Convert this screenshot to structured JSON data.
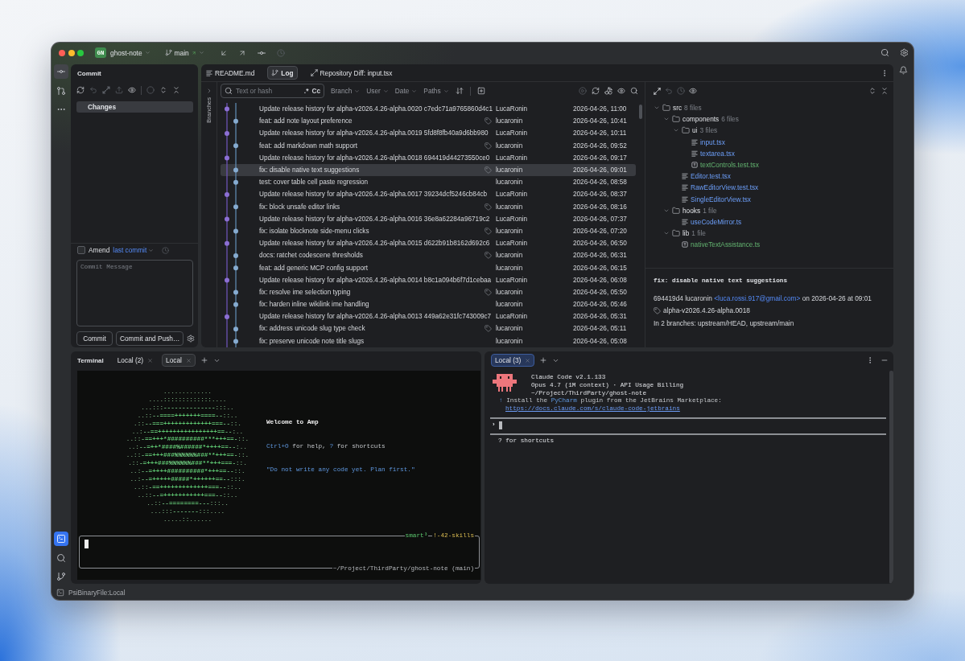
{
  "window": {
    "project_badge": "GN",
    "project": "ghost-note",
    "branch": "main"
  },
  "tool_strip": {
    "top": [
      {
        "selected": true
      },
      {
        "selected": false
      },
      {
        "selected": false
      }
    ],
    "bottom": [
      {
        "selected": true
      },
      {
        "selected": false
      },
      {
        "selected": false
      }
    ]
  },
  "commit_panel": {
    "title": "Commit",
    "changes": {
      "label": "Changes",
      "selected": true
    },
    "amend": {
      "checked": false,
      "label": "Amend",
      "link": "last commit"
    },
    "message": {
      "placeholder": "Commit Message"
    },
    "buttons": [
      "Commit",
      "Commit and Push…"
    ]
  },
  "editor_tabs": [
    {
      "label": "README.md",
      "selected": false
    },
    {
      "label": "Log",
      "selected": true
    },
    {
      "label": "Repository Diff: input.tsx",
      "selected": false
    }
  ],
  "log": {
    "branches_label": "Branches",
    "search": {
      "placeholder": "Text or hash",
      "regex": ".*",
      "match_case": "Cc"
    },
    "filters": [
      "Branch",
      "User",
      "Date",
      "Paths"
    ],
    "rows": [
      {
        "kind": "left",
        "message": "Update release history for alpha-v2026.4.26-alpha.0020 c7edc71a9765860d4c1",
        "tagged": false,
        "author": "LucaRonin",
        "date": "2026-04-26, 11:00",
        "selected": false
      },
      {
        "kind": "right",
        "message": "feat: add note layout preference",
        "tagged": true,
        "author": "lucaronin",
        "date": "2026-04-26, 10:41",
        "selected": false
      },
      {
        "kind": "left",
        "message": "Update release history for alpha-v2026.4.26-alpha.0019 5fd8f8fb40a9d6bb980",
        "tagged": false,
        "author": "LucaRonin",
        "date": "2026-04-26, 10:11",
        "selected": false
      },
      {
        "kind": "right",
        "message": "feat: add markdown math support",
        "tagged": true,
        "author": "lucaronin",
        "date": "2026-04-26, 09:52",
        "selected": false
      },
      {
        "kind": "left",
        "message": "Update release history for alpha-v2026.4.26-alpha.0018 694419d44273550ce0",
        "tagged": false,
        "author": "LucaRonin",
        "date": "2026-04-26, 09:17",
        "selected": false
      },
      {
        "kind": "right",
        "message": "fix: disable native text suggestions",
        "tagged": true,
        "author": "lucaronin",
        "date": "2026-04-26, 09:01",
        "selected": true
      },
      {
        "kind": "right",
        "message": "test: cover table cell paste regression",
        "tagged": false,
        "author": "lucaronin",
        "date": "2026-04-26, 08:58",
        "selected": false
      },
      {
        "kind": "left",
        "message": "Update release history for alpha-v2026.4.26-alpha.0017 39234dcf5246cb84cb",
        "tagged": false,
        "author": "LucaRonin",
        "date": "2026-04-26, 08:37",
        "selected": false
      },
      {
        "kind": "right",
        "message": "fix: block unsafe editor links",
        "tagged": true,
        "author": "lucaronin",
        "date": "2026-04-26, 08:16",
        "selected": false
      },
      {
        "kind": "left",
        "message": "Update release history for alpha-v2026.4.26-alpha.0016 36e8a62284a96719c2",
        "tagged": false,
        "author": "LucaRonin",
        "date": "2026-04-26, 07:37",
        "selected": false
      },
      {
        "kind": "right",
        "message": "fix: isolate blocknote side-menu clicks",
        "tagged": true,
        "author": "lucaronin",
        "date": "2026-04-26, 07:20",
        "selected": false
      },
      {
        "kind": "left",
        "message": "Update release history for alpha-v2026.4.26-alpha.0015 d622b91b8162d692c6",
        "tagged": false,
        "author": "LucaRonin",
        "date": "2026-04-26, 06:50",
        "selected": false
      },
      {
        "kind": "right",
        "message": "docs: ratchet codescene thresholds",
        "tagged": true,
        "author": "lucaronin",
        "date": "2026-04-26, 06:31",
        "selected": false
      },
      {
        "kind": "right",
        "message": "feat: add generic MCP config support",
        "tagged": false,
        "author": "lucaronin",
        "date": "2026-04-26, 06:15",
        "selected": false
      },
      {
        "kind": "left",
        "message": "Update release history for alpha-v2026.4.26-alpha.0014 b8c1a094b6f7d1cebaa",
        "tagged": false,
        "author": "LucaRonin",
        "date": "2026-04-26, 06:08",
        "selected": false
      },
      {
        "kind": "right",
        "message": "fix: resolve ime selection typing",
        "tagged": true,
        "author": "lucaronin",
        "date": "2026-04-26, 05:50",
        "selected": false
      },
      {
        "kind": "right",
        "message": "fix: harden inline wikilink ime handling",
        "tagged": false,
        "author": "lucaronin",
        "date": "2026-04-26, 05:46",
        "selected": false
      },
      {
        "kind": "left",
        "message": "Update release history for alpha-v2026.4.26-alpha.0013 449a62e31fc743009c7",
        "tagged": false,
        "author": "LucaRonin",
        "date": "2026-04-26, 05:31",
        "selected": false
      },
      {
        "kind": "right",
        "message": "fix: address unicode slug type check",
        "tagged": true,
        "author": "lucaronin",
        "date": "2026-04-26, 05:11",
        "selected": false
      },
      {
        "kind": "right",
        "message": "fix: preserve unicode note title slugs",
        "tagged": false,
        "author": "lucaronin",
        "date": "2026-04-26, 05:08",
        "selected": false
      }
    ]
  },
  "details": {
    "tree": [
      {
        "kind": "folder",
        "name": "src",
        "count": "8 files",
        "expanded": true,
        "children": [
          {
            "kind": "folder",
            "name": "components",
            "count": "6 files",
            "expanded": true,
            "children": [
              {
                "kind": "folder",
                "name": "ui",
                "count": "3 files",
                "expanded": true,
                "children": [
                  {
                    "kind": "modified",
                    "name": "input.tsx"
                  },
                  {
                    "kind": "modified",
                    "name": "textarea.tsx"
                  },
                  {
                    "kind": "added",
                    "name": "textControls.test.tsx"
                  }
                ]
              },
              {
                "kind": "modified",
                "name": "Editor.test.tsx"
              },
              {
                "kind": "modified",
                "name": "RawEditorView.test.tsx"
              },
              {
                "kind": "modified",
                "name": "SingleEditorView.tsx"
              }
            ]
          },
          {
            "kind": "folder",
            "name": "hooks",
            "count": "1 file",
            "expanded": true,
            "children": [
              {
                "kind": "modified",
                "name": "useCodeMirror.ts"
              }
            ]
          },
          {
            "kind": "folder",
            "name": "lib",
            "count": "1 file",
            "expanded": true,
            "children": [
              {
                "kind": "added",
                "name": "nativeTextAssistance.ts"
              }
            ]
          }
        ]
      }
    ],
    "commit": {
      "title": "fix: disable native text suggestions",
      "hash_author": "694419d4 lucaronin",
      "email": "<luca.rossi.917@gmail.com>",
      "date": "on 2026-04-26 at 09:01",
      "tag": "alpha-v2026.4.26-alpha.0018",
      "branches": "In 2 branches: upstream/HEAD, upstream/main"
    }
  },
  "terminal": {
    "title": "Terminal",
    "tabs": [
      {
        "label": "Local (2)",
        "selected": false
      },
      {
        "label": "Local",
        "selected": true
      }
    ],
    "art": [
      ".............",
      "....:::::::::::::....",
      "...:::--------------:::..",
      "..::--====+++++++====--::..",
      ".::--===+++++++++++++===--::.",
      "..:--==++++++++++++++++==--:..",
      "..::-==+++*##########***+++==-::.",
      "..:--=++*####%######*++++==--:..",
      "..::-==+++###%%%%%%###**+++==-::.",
      ".::-=+++###%%%%%%###**+++===-::.",
      "..:--=++++##########*+++==--::.",
      "..:--=+++++#####*++++++==--:::.",
      "..::-==+++++++++++++===--::..",
      "..::--=+++++++++++===--::..",
      "..::--========---:::..",
      "...:::-------:::....",
      ".....::......"
    ],
    "welcome": "Welcome to Amp",
    "help": [
      {
        "text": "Ctrl+O",
        "highlight": true
      },
      {
        "text": "for help,",
        "highlight": false
      },
      {
        "text": "?",
        "highlight": true
      },
      {
        "text": "for shortcuts",
        "highlight": false
      }
    ],
    "quote": "\"Do not write any code yet. Plan first.\"",
    "prompt": {
      "mode": "smart³",
      "skills": "!-42-skills",
      "path": "~/Project/ThirdParty/ghost-note (main)"
    }
  },
  "claude_terminal": {
    "tabs": [
      {
        "label": "Local (3)",
        "selected": true
      }
    ],
    "header": [
      "Claude Code v2.1.133",
      "Opus 4.7 (1M context) · API Usage Billing",
      "~/Project/ThirdParty/ghost-note"
    ],
    "install": [
      {
        "text": "↑",
        "highlight": true
      },
      {
        "text": "Install the",
        "highlight": false
      },
      {
        "text": "PyCharm",
        "highlight": true
      },
      {
        "text": "plugin from the JetBrains Marketplace:",
        "highlight": false
      }
    ],
    "link": "https://docs.claude.com/s/claude-code-jetbrains",
    "prompt_symbol": "›",
    "hint": "? for shortcuts"
  },
  "status_bar": {
    "text": "PsiBinaryFile:Local"
  }
}
